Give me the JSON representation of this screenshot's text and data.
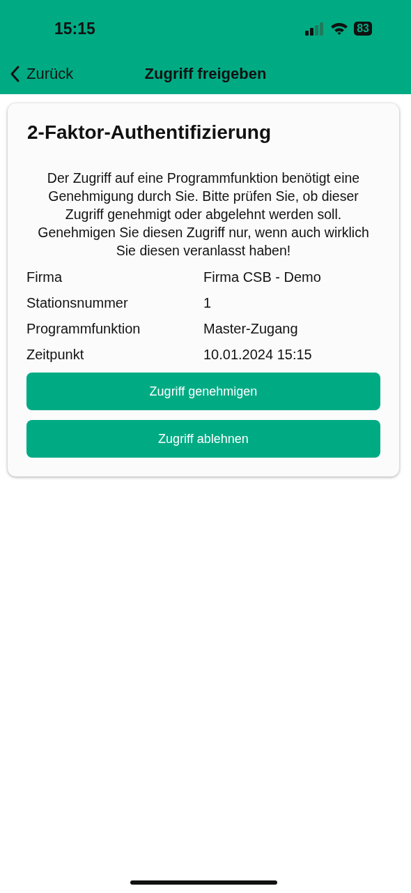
{
  "status_bar": {
    "time": "15:15",
    "battery": "83"
  },
  "nav": {
    "back": "Zurück",
    "title": "Zugriff freigeben"
  },
  "card": {
    "title": "2-Faktor-Authentifizierung",
    "message": "Der Zugriff auf eine Programmfunktion benötigt eine Genehmigung durch Sie. Bitte prüfen Sie, ob dieser Zugriff genehmigt oder abgelehnt werden soll. Genehmigen Sie diesen Zugriff nur, wenn auch wirklich Sie diesen veranlasst haben!",
    "details": [
      {
        "label": "Firma",
        "value": "Firma CSB - Demo"
      },
      {
        "label": "Stationsnummer",
        "value": "1"
      },
      {
        "label": "Programmfunktion",
        "value": "Master-Zugang"
      },
      {
        "label": "Zeitpunkt",
        "value": "10.01.2024 15:15"
      }
    ],
    "buttons": [
      "Zugriff genehmigen",
      "Zugriff ablehnen"
    ]
  }
}
